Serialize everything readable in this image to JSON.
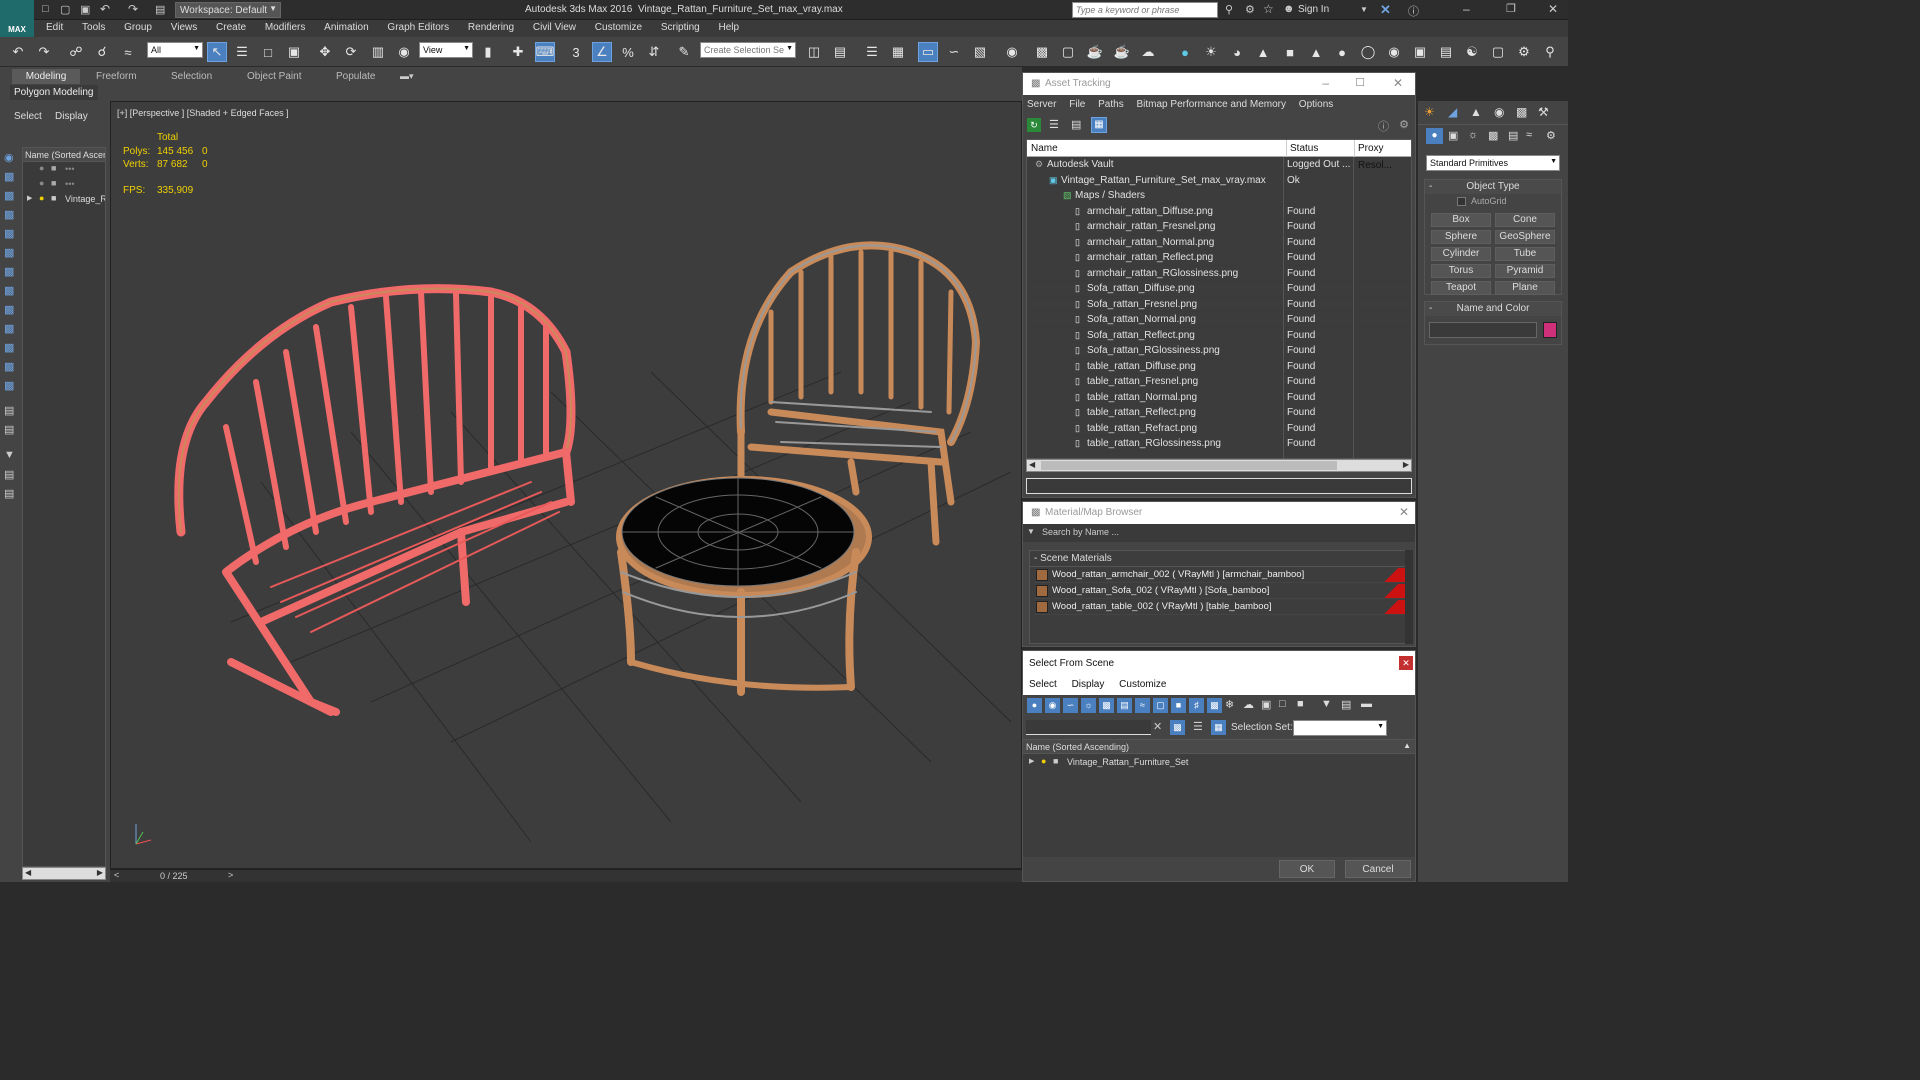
{
  "titlebar": {
    "workspace_label": "Workspace: Default",
    "app_title": "Autodesk 3ds Max 2016",
    "file_title": "Vintage_Rattan_Furniture_Set_max_vray.max",
    "search_placeholder": "Type a keyword or phrase",
    "sign_in": "Sign In",
    "logo_text": "MAX"
  },
  "menu": [
    "Edit",
    "Tools",
    "Group",
    "Views",
    "Create",
    "Modifiers",
    "Animation",
    "Graph Editors",
    "Rendering",
    "Civil View",
    "Customize",
    "Scripting",
    "Help"
  ],
  "toolbar": {
    "filter_value": "All",
    "refcoord_value": "View",
    "selection_set_placeholder": "Create Selection Se",
    "snap_label": "3"
  },
  "ribbon": {
    "tabs": [
      "Modeling",
      "Freeform",
      "Selection",
      "Object Paint",
      "Populate"
    ],
    "sub_label": "Polygon Modeling"
  },
  "scene_explorer": {
    "tabs": [
      "Select",
      "Display"
    ],
    "header": "Name (Sorted Ascend",
    "items": [
      "•••",
      "•••",
      "Vintage_R"
    ]
  },
  "viewport": {
    "label": "[+] [Perspective ] [Shaded + Edged Faces ]",
    "stats_header": "Total",
    "polys_label": "Polys:",
    "polys_value": "145 456",
    "polys_sel": "0",
    "verts_label": "Verts:",
    "verts_value": "87 682",
    "verts_sel": "0",
    "fps_label": "FPS:",
    "fps_value": "335,909"
  },
  "timeline": {
    "frame": "0 / 225"
  },
  "asset_tracking": {
    "title": "Asset Tracking",
    "menu": [
      "Server",
      "File",
      "Paths",
      "Bitmap Performance and Memory",
      "Options"
    ],
    "columns": [
      "Name",
      "Status",
      "Proxy Resol..."
    ],
    "rows": [
      {
        "name": "Autodesk Vault",
        "status": "Logged Out ..."
      },
      {
        "name": "Vintage_Rattan_Furniture_Set_max_vray.max",
        "status": "Ok"
      },
      {
        "name": "Maps / Shaders",
        "status": ""
      },
      {
        "name": "armchair_rattan_Diffuse.png",
        "status": "Found"
      },
      {
        "name": "armchair_rattan_Fresnel.png",
        "status": "Found"
      },
      {
        "name": "armchair_rattan_Normal.png",
        "status": "Found"
      },
      {
        "name": "armchair_rattan_Reflect.png",
        "status": "Found"
      },
      {
        "name": "armchair_rattan_RGlossiness.png",
        "status": "Found"
      },
      {
        "name": "Sofa_rattan_Diffuse.png",
        "status": "Found"
      },
      {
        "name": "Sofa_rattan_Fresnel.png",
        "status": "Found"
      },
      {
        "name": "Sofa_rattan_Normal.png",
        "status": "Found"
      },
      {
        "name": "Sofa_rattan_Reflect.png",
        "status": "Found"
      },
      {
        "name": "Sofa_rattan_RGlossiness.png",
        "status": "Found"
      },
      {
        "name": "table_rattan_Diffuse.png",
        "status": "Found"
      },
      {
        "name": "table_rattan_Fresnel.png",
        "status": "Found"
      },
      {
        "name": "table_rattan_Normal.png",
        "status": "Found"
      },
      {
        "name": "table_rattan_Reflect.png",
        "status": "Found"
      },
      {
        "name": "table_rattan_Refract.png",
        "status": "Found"
      },
      {
        "name": "table_rattan_RGlossiness.png",
        "status": "Found"
      }
    ]
  },
  "material_browser": {
    "title": "Material/Map Browser",
    "search_placeholder": "Search by Name ...",
    "group_label": "- Scene Materials",
    "materials": [
      "Wood_rattan_armchair_002  ( VRayMtl ) [armchair_bamboo]",
      "Wood_rattan_Sofa_002  ( VRayMtl ) [Sofa_bamboo]",
      "Wood_rattan_table_002  ( VRayMtl ) [table_bamboo]"
    ]
  },
  "select_from_scene": {
    "title": "Select From Scene",
    "menu": [
      "Select",
      "Display",
      "Customize"
    ],
    "selection_set_label": "Selection Set:",
    "column_header": "Name (Sorted Ascending)",
    "items": [
      "Vintage_Rattan_Furniture_Set"
    ],
    "ok": "OK",
    "cancel": "Cancel"
  },
  "command_panel": {
    "dropdown_value": "Standard Primitives",
    "object_type_header": "Object Type",
    "autogrid": "AutoGrid",
    "buttons": [
      "Box",
      "Cone",
      "Sphere",
      "GeoSphere",
      "Cylinder",
      "Tube",
      "Torus",
      "Pyramid",
      "Teapot",
      "Plane"
    ],
    "name_color_header": "Name and Color",
    "color_swatch": "#d0307a"
  },
  "colors": {
    "accent": "#4a7fc0",
    "sofa_wire": "#f06a6a",
    "rattan": "#c98a5a",
    "status_red": "#cc1111"
  }
}
